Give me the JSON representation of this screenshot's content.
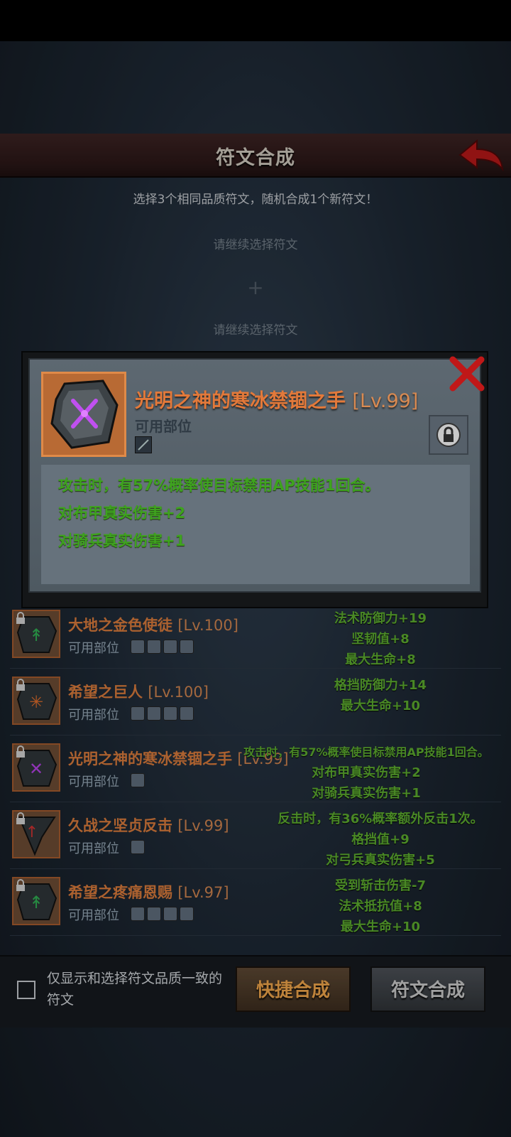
{
  "header": {
    "title": "符文合成"
  },
  "subtitle": "选择3个相同品质符文，随机合成1个新符文！",
  "slots": {
    "top": "请继续选择符文",
    "plus": "+",
    "bottom": "请继续选择符文"
  },
  "list": {
    "parts_label": "可用部位",
    "rows": [
      {
        "name": "大地之金色使徒",
        "level": "[Lv.100]",
        "rune_color": "#2fa850",
        "stats": [
          "法术防御力+19",
          "坚韧值+8",
          "最大生命+8"
        ]
      },
      {
        "name": "希望之巨人",
        "level": "[Lv.100]",
        "rune_color": "#d86a2a",
        "stats": [
          "格挡防御力+14",
          "最大生命+10"
        ]
      },
      {
        "name": "光明之神的寒冰禁锢之手",
        "level": "[Lv.99]",
        "rune_color": "#b040e0",
        "stats": [
          "攻击时，有57%概率使目标禁用AP技能1回合。",
          "对布甲真实伤害+2",
          "对骑兵真实伤害+1"
        ]
      },
      {
        "name": "久战之坚贞反击",
        "level": "[Lv.99]",
        "rune_color": "#c83030",
        "stats": [
          "反击时，有36%概率额外反击1次。",
          "格挡值+9",
          "对弓兵真实伤害+5"
        ]
      },
      {
        "name": "希望之疼痛恩赐",
        "level": "[Lv.97]",
        "rune_color": "#2fa850",
        "stats": [
          "受到斩击伤害-7",
          "法术抵抗值+8",
          "最大生命+10"
        ]
      }
    ]
  },
  "bottom": {
    "checkbox_label": "仅显示和选择符文品质一致的符文",
    "quick_button": "快捷合成",
    "compose_button": "符文合成"
  },
  "modal": {
    "name": "光明之神的寒冰禁锢之手",
    "level": "[Lv.99]",
    "parts_label": "可用部位",
    "effects": [
      "攻击时，有57%概率使目标禁用AP技能1回合。",
      "对布甲真实伤害+2",
      "对骑兵真实伤害+1"
    ],
    "icons": {
      "close": "close-icon",
      "lock": "lock-icon",
      "rune": "rune-icon"
    }
  },
  "colors": {
    "accent_orange": "#e3793a",
    "effect_green": "#3ea31e",
    "stat_green": "#5aa62e"
  }
}
